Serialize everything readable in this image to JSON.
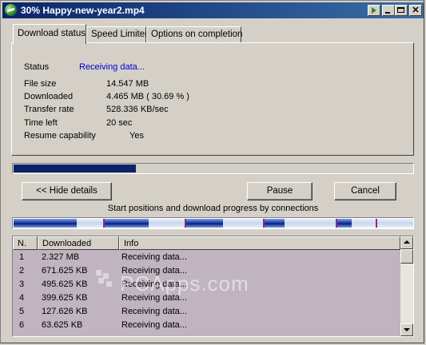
{
  "window": {
    "title": "30% Happy-new-year2.mp4"
  },
  "tabs": [
    {
      "label": "Download status",
      "active": true
    },
    {
      "label": "Speed Limiter",
      "active": false
    },
    {
      "label": "Options on completion",
      "active": false
    }
  ],
  "status": {
    "status_label": "Status",
    "status_value": "Receiving data...",
    "fields": [
      {
        "label": "File size",
        "value": "14.547  MB"
      },
      {
        "label": "Downloaded",
        "value": "4.465  MB  ( 30.69 % )"
      },
      {
        "label": "Transfer rate",
        "value": "528.336  KB/sec"
      },
      {
        "label": "Time left",
        "value": "20 sec"
      },
      {
        "label": "Resume capability",
        "value": "Yes"
      }
    ]
  },
  "progress": {
    "fraction": 0.3069,
    "color": "#0a246a"
  },
  "buttons": {
    "hide_details": "<< Hide details",
    "pause": "Pause",
    "cancel": "Cancel"
  },
  "connections": {
    "caption": "Start positions and download progress by connections",
    "columns": {
      "n": "N.",
      "downloaded": "Downloaded",
      "info": "Info"
    },
    "rows": [
      {
        "n": "1",
        "downloaded": "2.327  MB",
        "info": "Receiving data..."
      },
      {
        "n": "2",
        "downloaded": "671.625  KB",
        "info": "Receiving data..."
      },
      {
        "n": "3",
        "downloaded": "495.625  KB",
        "info": "Receiving data..."
      },
      {
        "n": "4",
        "downloaded": "399.625  KB",
        "info": "Receiving data..."
      },
      {
        "n": "5",
        "downloaded": "127.626  KB",
        "info": "Receiving data..."
      },
      {
        "n": "6",
        "downloaded": "63.625  KB",
        "info": "Receiving data..."
      }
    ]
  },
  "watermark": "PCApps.com"
}
